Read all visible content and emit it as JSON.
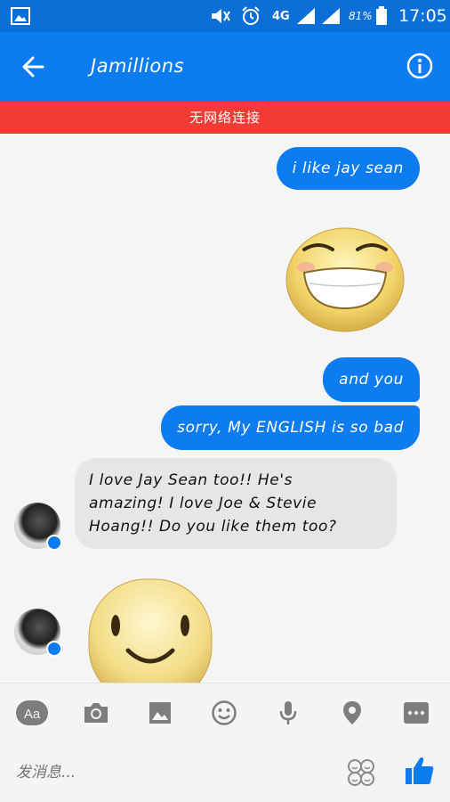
{
  "status_bar": {
    "network": "4G",
    "battery_percent": "81%",
    "time": "17:05",
    "icons": [
      "gallery-icon",
      "mute-icon",
      "alarm-icon",
      "signal-icon",
      "battery-icon"
    ]
  },
  "app_bar": {
    "back_icon": "arrow-left-icon",
    "title": "Jamillions",
    "info_icon": "info-icon"
  },
  "offline_banner": "无网络连接",
  "messages": {
    "outgoing_1": "i like jay sean",
    "sticker_1": "laughing-face-sticker",
    "outgoing_2": "and you",
    "outgoing_3": "sorry, My ENGLISH is so bad",
    "incoming_1": "I love Jay Sean too!! He's\namazing! I love Joe & Stevie\nHoang!! Do you like them too?",
    "sticker_2": "smiling-face-sticker"
  },
  "composer": {
    "tools": [
      "text-format-icon",
      "camera-icon",
      "image-icon",
      "emoji-icon",
      "mic-icon",
      "location-icon",
      "more-icon"
    ],
    "aa_label": "Aa",
    "placeholder": "发消息...",
    "stickers_icon": "stickers-icon",
    "like_icon": "thumbs-up-icon"
  },
  "colors": {
    "status_bar": "#0a6fd6",
    "app_bar": "#0c7cf0",
    "offline": "#f13b34",
    "outgoing_bubble": "#0c7cf0",
    "incoming_bubble": "#e6e6e6",
    "composer_icons": "#7d7d7d"
  }
}
